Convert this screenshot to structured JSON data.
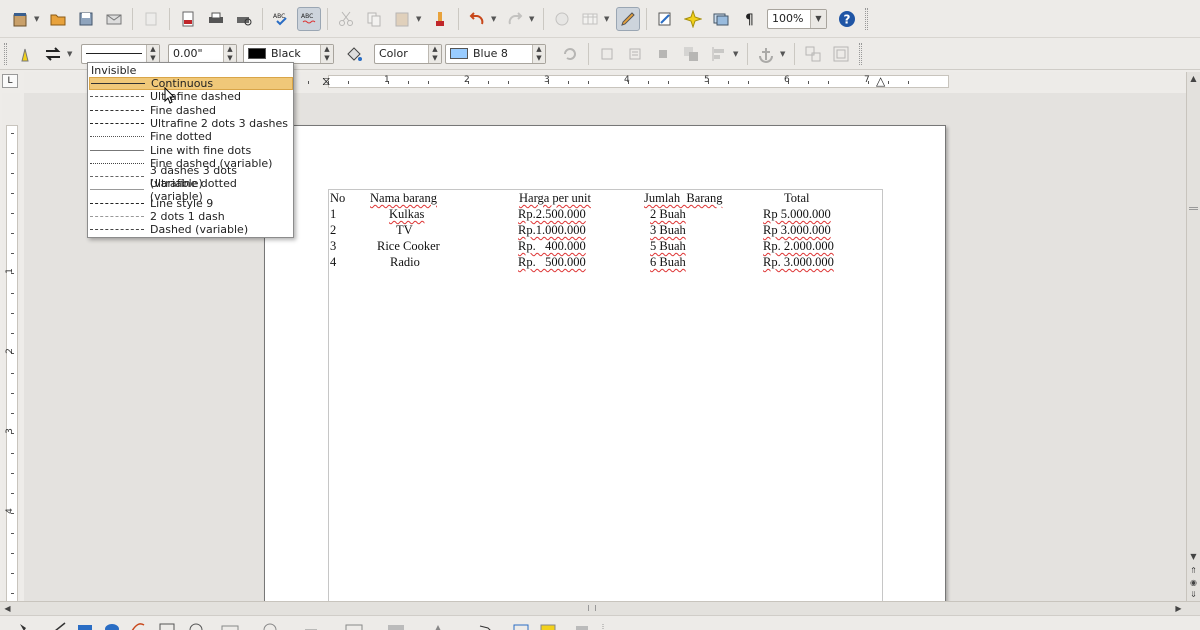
{
  "toolbar2": {
    "line_width": "0.00\"",
    "line_color": "Black",
    "line_color_hex": "#000000",
    "area_style": "Color",
    "area_color": "Blue 8",
    "area_color_hex": "#99ccff"
  },
  "toolbar1": {
    "zoom": "100%"
  },
  "ruler": {
    "corner": "L",
    "h_numbers": [
      "1",
      "2",
      "3",
      "4",
      "5",
      "6",
      "7"
    ],
    "v_numbers": [
      "1",
      "2",
      "3",
      "4"
    ]
  },
  "line_style_menu": {
    "header": "Invisible",
    "selected_index": 0,
    "items": [
      {
        "label": "Continuous",
        "style": "continuous"
      },
      {
        "label": "Ultrafine dashed",
        "style": "ultrafine-dashed"
      },
      {
        "label": "Fine dashed",
        "style": "fine-dashed"
      },
      {
        "label": "Ultrafine 2 dots 3 dashes",
        "style": "dots-dashes"
      },
      {
        "label": "Fine dotted",
        "style": "fine-dotted"
      },
      {
        "label": "Line with fine dots",
        "style": "line-fine-dots"
      },
      {
        "label": "Fine dashed (variable)",
        "style": "fine-dashed-var"
      },
      {
        "label": "3 dashes 3 dots (variable)",
        "style": "dashes-dots-var"
      },
      {
        "label": "Ultrafine dotted (variable)",
        "style": "ultrafine-dotted-var"
      },
      {
        "label": "Line style 9",
        "style": "line-style-9"
      },
      {
        "label": "2 dots 1 dash",
        "style": "dots-dash"
      },
      {
        "label": "Dashed (variable)",
        "style": "dashed-var"
      }
    ]
  },
  "table": {
    "headers": [
      "No",
      "Nama barang",
      "Harga per unit",
      "Jumlah  Barang",
      "Total"
    ],
    "rows": [
      [
        "1",
        "Kulkas",
        "Rp.2.500.000",
        "2 Buah",
        "Rp 5.000.000"
      ],
      [
        "2",
        "TV",
        "Rp.1.000.000",
        "3 Buah",
        "Rp 3.000.000"
      ],
      [
        "3",
        "Rice Cooker",
        "Rp.   400.000",
        "5 Buah",
        "Rp. 2.000.000"
      ],
      [
        "4",
        "Radio",
        "Rp.   500.000",
        "6 Buah",
        "Rp. 3.000.000"
      ]
    ]
  }
}
